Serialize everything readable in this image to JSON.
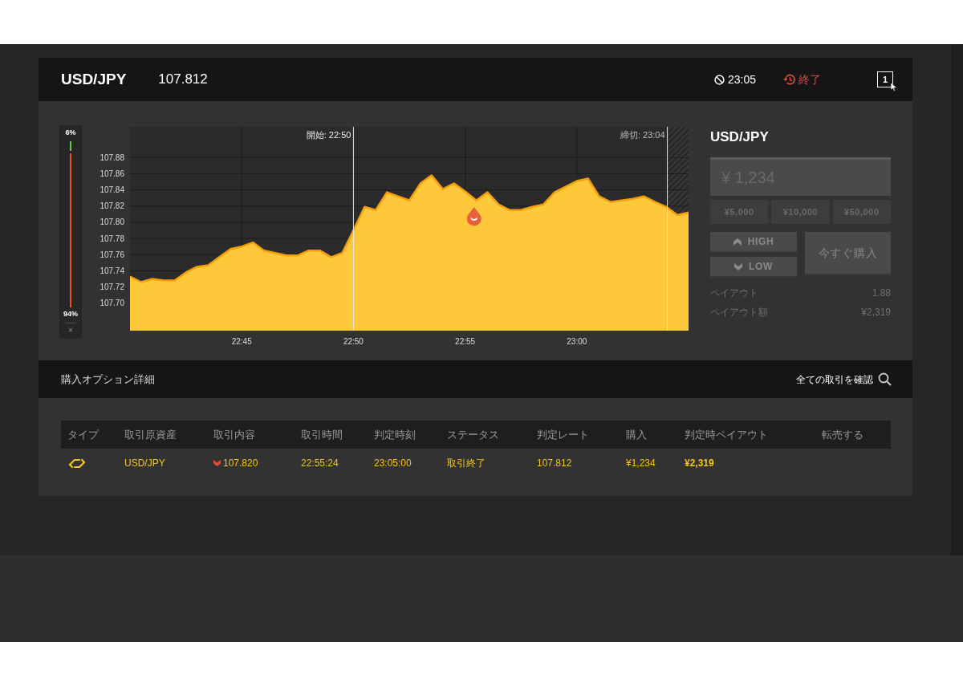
{
  "header": {
    "pair": "USD/JPY",
    "price": "107.812",
    "expiry": "23:05",
    "status": "終了",
    "window_badge": "1"
  },
  "gauge": {
    "high": "6%",
    "low": "94%",
    "level": 0.06,
    "close": "×"
  },
  "chart": {
    "chart_data": {
      "type": "area",
      "categories": [
        null,
        null,
        null,
        null,
        null,
        null,
        null,
        null,
        null,
        null,
        "22:45",
        null,
        null,
        null,
        null,
        null,
        null,
        null,
        null,
        null,
        "22:50",
        null,
        null,
        null,
        null,
        null,
        null,
        null,
        null,
        null,
        "22:55",
        null,
        null,
        null,
        null,
        null,
        null,
        null,
        null,
        null,
        "23:00",
        null,
        null,
        null,
        null,
        null,
        null,
        null,
        null,
        null,
        null
      ],
      "series": [
        {
          "color": "#ffc83a",
          "values": [
            107.733,
            107.726,
            107.73,
            107.728,
            107.728,
            107.738,
            107.745,
            107.747,
            107.757,
            107.767,
            107.77,
            107.775,
            107.765,
            107.762,
            107.759,
            107.759,
            107.765,
            107.765,
            107.757,
            107.762,
            107.79,
            107.819,
            107.815,
            107.837,
            107.832,
            107.827,
            107.848,
            107.858,
            107.841,
            107.848,
            107.838,
            107.827,
            107.837,
            107.822,
            107.815,
            107.815,
            107.819,
            107.822,
            107.837,
            107.844,
            107.851,
            107.854,
            107.832,
            107.825,
            107.827,
            107.829,
            107.832,
            107.825,
            107.819,
            107.809,
            107.812
          ]
        }
      ],
      "ylim": [
        107.666,
        107.918
      ],
      "yticks": [
        {
          "value": 107.7,
          "label": "107.70"
        },
        {
          "value": 107.72,
          "label": "107.72"
        },
        {
          "value": 107.74,
          "label": "107.74"
        },
        {
          "value": 107.76,
          "label": "107.76"
        },
        {
          "value": 107.78,
          "label": "107.78"
        },
        {
          "value": 107.8,
          "label": "107.80"
        },
        {
          "value": 107.82,
          "label": "107.82"
        },
        {
          "value": 107.84,
          "label": "107.84"
        },
        {
          "value": 107.86,
          "label": "107.86"
        },
        {
          "value": 107.88,
          "label": "107.88"
        }
      ],
      "grid": true
    },
    "markers": [
      {
        "label": "開始: 22:50"
      },
      {
        "label": "締切: 23:04"
      }
    ]
  },
  "order": {
    "pair": "USD/JPY",
    "amount": {
      "placeholder": "¥ 1,234"
    },
    "presets": [
      "¥5,000",
      "¥10,000",
      "¥50,000"
    ],
    "high": {
      "label": "HIGH",
      "disabled": true
    },
    "low": {
      "label": "LOW",
      "disabled": true
    },
    "buy": {
      "label": "今すぐ購入",
      "disabled": true
    },
    "payout": [
      {
        "label": "ペイアウト",
        "value": "1.88"
      },
      {
        "label": "ペイアウト額",
        "value": "¥2,319"
      }
    ]
  },
  "details": {
    "title": "購入オプション詳細",
    "link": "全ての取引を確認",
    "columns": [
      "タイプ",
      "取引原資産",
      "取引内容",
      "取引時間",
      "判定時刻",
      "ステータス",
      "判定レート",
      "購入",
      "判定時ペイアウト",
      "転売する"
    ],
    "rows": [
      {
        "asset": "USD/JPY",
        "high": false,
        "strike": "107.820",
        "trade_time": "22:55:24",
        "judge_time": "23:05:00",
        "status": "取引終了",
        "rate": "107.812",
        "amount": "¥1,234",
        "payout": "¥2,319"
      }
    ]
  }
}
